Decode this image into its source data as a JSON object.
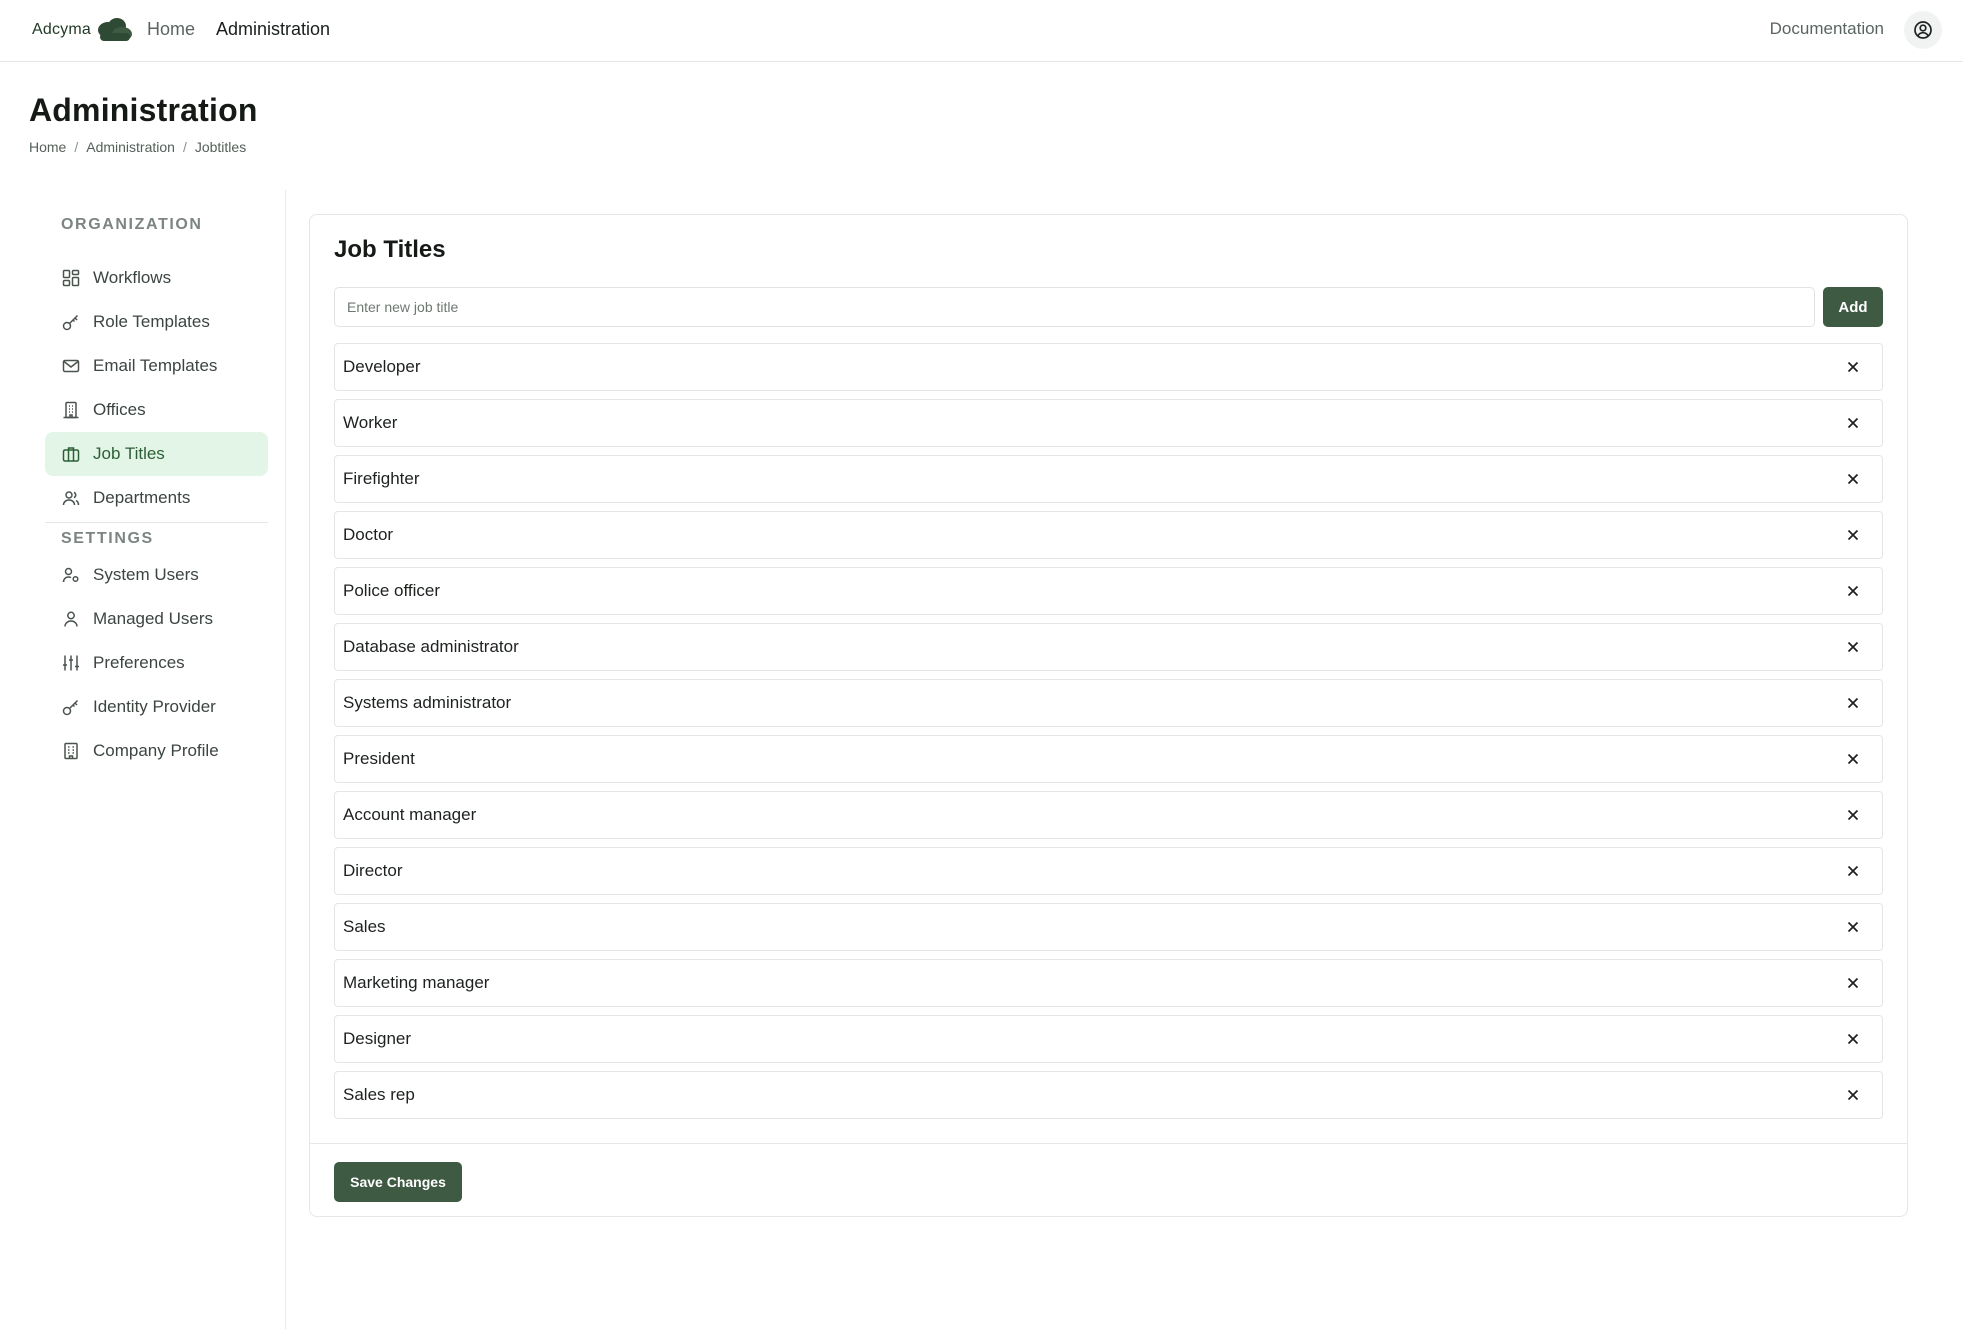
{
  "brand": {
    "name": "Adcyma",
    "logo_icon": "cloud-logo-icon",
    "accent": "#3f5a43"
  },
  "nav": {
    "home": "Home",
    "administration": "Administration",
    "documentation": "Documentation",
    "account_icon": "user-circle-icon"
  },
  "page": {
    "title": "Administration",
    "breadcrumb": [
      "Home",
      "Administration",
      "Jobtitles"
    ]
  },
  "sidebar": {
    "organization_label": "ORGANIZATION",
    "settings_label": "SETTINGS",
    "organization_items": [
      {
        "label": "Workflows",
        "icon": "grid-icon"
      },
      {
        "label": "Role Templates",
        "icon": "key-icon"
      },
      {
        "label": "Email Templates",
        "icon": "mail-icon"
      },
      {
        "label": "Offices",
        "icon": "building-icon"
      },
      {
        "label": "Job Titles",
        "icon": "briefcase-icon",
        "active": true
      },
      {
        "label": "Departments",
        "icon": "users-icon"
      }
    ],
    "settings_items": [
      {
        "label": "System Users",
        "icon": "user-cog-icon"
      },
      {
        "label": "Managed Users",
        "icon": "user-icon"
      },
      {
        "label": "Preferences",
        "icon": "sliders-icon"
      },
      {
        "label": "Identity Provider",
        "icon": "key-icon"
      },
      {
        "label": "Company Profile",
        "icon": "office-icon"
      }
    ]
  },
  "job_titles": {
    "title": "Job Titles",
    "input_placeholder": "Enter new job title",
    "input_value": "",
    "add_label": "Add",
    "save_label": "Save Changes",
    "items": [
      "Developer",
      "Worker",
      "Firefighter",
      "Doctor",
      "Police officer",
      "Database administrator",
      "Systems administrator",
      "President",
      "Account manager",
      "Director",
      "Sales",
      "Marketing manager",
      "Designer",
      "Sales rep"
    ]
  }
}
